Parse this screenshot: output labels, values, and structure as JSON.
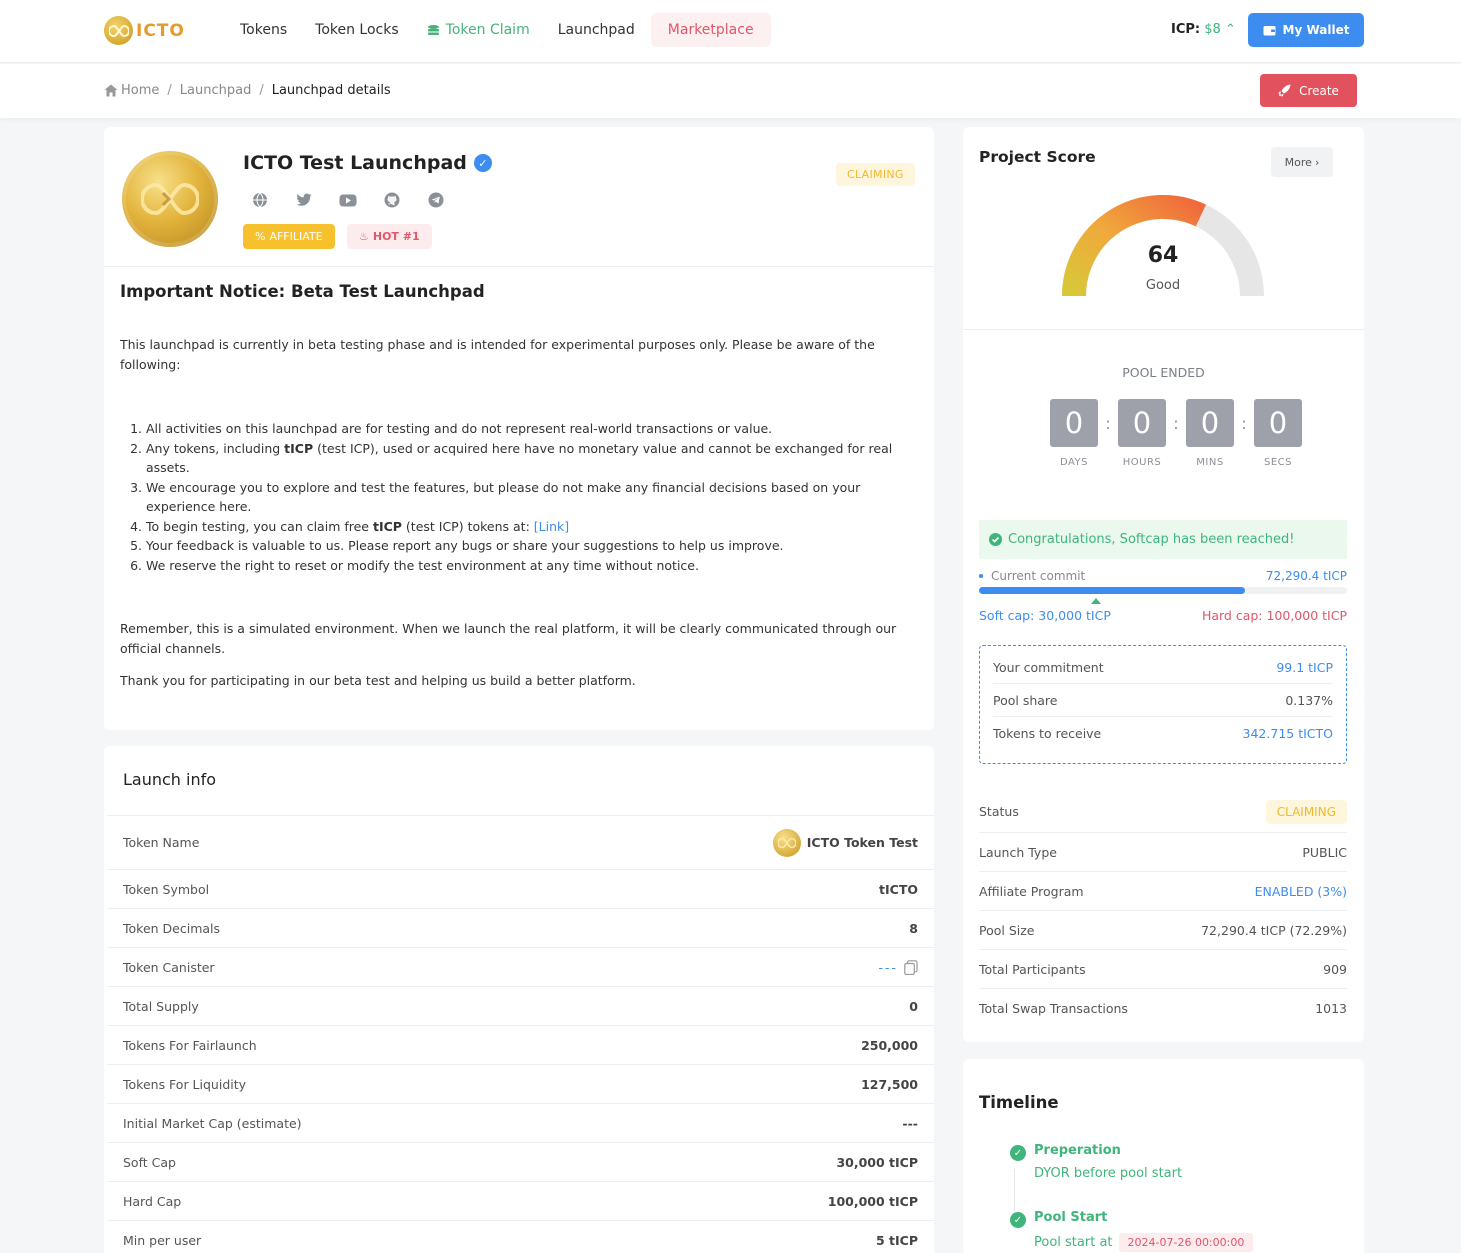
{
  "nav": {
    "logo_text": "ICTO",
    "items": [
      "Tokens",
      "Token Locks",
      "Token Claim",
      "Launchpad",
      "Marketplace"
    ],
    "icp_label": "ICP:",
    "icp_value": "$8",
    "wallet_label": "My Wallet"
  },
  "breadcrumb": {
    "home": "Home",
    "launchpad": "Launchpad",
    "current": "Launchpad details"
  },
  "create_label": "Create",
  "project": {
    "title": "ICTO Test Launchpad",
    "status": "CLAIMING",
    "affiliate_badge": "AFFILIATE",
    "hot_badge": "HOT #1"
  },
  "notice": {
    "heading": "Important Notice: Beta Test Launchpad",
    "intro": "This launchpad is currently in beta testing phase and is intended for experimental purposes only. Please be aware of the following:",
    "items": [
      [
        "All activities on this launchpad are for testing and do not represent real-world transactions or value."
      ],
      [
        "Any tokens, including ",
        "tICP",
        " (test ICP), used or acquired here have no monetary value and cannot be exchanged for real assets."
      ],
      [
        "We encourage you to explore and test the features, but please do not make any financial decisions based on your experience here."
      ],
      [
        "To begin testing, you can claim free ",
        "tICP",
        " (test ICP) tokens at: ",
        "[Link]"
      ],
      [
        "Your feedback is valuable to us. Please report any bugs or share your suggestions to help us improve."
      ],
      [
        "We reserve the right to reset or modify the test environment at any time without notice."
      ]
    ],
    "outro1": "Remember, this is a simulated environment. When we launch the real platform, it will be clearly communicated through our official channels.",
    "outro2": "Thank you for participating in our beta test and helping us build a better platform."
  },
  "launch_info": {
    "title": "Launch info",
    "rows": [
      {
        "k": "Token Name",
        "v": "ICTO Token Test"
      },
      {
        "k": "Token Symbol",
        "v": "tICTO"
      },
      {
        "k": "Token Decimals",
        "v": "8"
      },
      {
        "k": "Token Canister",
        "v": "---"
      },
      {
        "k": "Total Supply",
        "v": "0"
      },
      {
        "k": "Tokens For Fairlaunch",
        "v": "250,000"
      },
      {
        "k": "Tokens For Liquidity",
        "v": "127,500"
      },
      {
        "k": "Initial Market Cap (estimate)",
        "v": "---"
      },
      {
        "k": "Soft Cap",
        "v": "30,000 tICP"
      },
      {
        "k": "Hard Cap",
        "v": "100,000 tICP"
      },
      {
        "k": "Min per user",
        "v": "5 tICP"
      }
    ]
  },
  "score": {
    "title": "Project Score",
    "more": "More",
    "value": "64",
    "value_num": 64,
    "label": "Good"
  },
  "pool": {
    "ended_label": "POOL ENDED",
    "timer": [
      {
        "n": "0",
        "l": "DAYS"
      },
      {
        "n": "0",
        "l": "HOURS"
      },
      {
        "n": "0",
        "l": "MINS"
      },
      {
        "n": "0",
        "l": "SECS"
      }
    ],
    "congrats": "Congratulations, Softcap has been reached!",
    "current_commit_label": "Current commit",
    "current_commit_value": "72,290.4 tICP",
    "progress": 0.7229,
    "soft_cap": "Soft cap: 30,000 tICP",
    "hard_cap": "Hard cap: 100,000 tICP",
    "commitment": [
      {
        "k": "Your commitment",
        "v": "99.1 tICP"
      },
      {
        "k": "Pool share",
        "v": "0.137%"
      },
      {
        "k": "Tokens to receive",
        "v": "342.715 tICTO"
      }
    ],
    "stats": [
      {
        "k": "Status",
        "v": "CLAIMING"
      },
      {
        "k": "Launch Type",
        "v": "PUBLIC"
      },
      {
        "k": "Affiliate Program",
        "v": "ENABLED (3%)"
      },
      {
        "k": "Pool Size",
        "v": "72,290.4 tICP (72.29%)"
      },
      {
        "k": "Total Participants",
        "v": "909"
      },
      {
        "k": "Total Swap Transactions",
        "v": "1013"
      }
    ]
  },
  "timeline": {
    "title": "Timeline",
    "items": [
      {
        "name": "Preperation",
        "desc": "DYOR before pool start"
      },
      {
        "name": "Pool Start",
        "desc": "Pool start at",
        "date": "2024-07-26 00:00:00"
      }
    ]
  },
  "colors": {
    "accent": "#3d8df0",
    "success": "#3fb57c",
    "danger": "#e2525e",
    "warning": "#f6c12d"
  }
}
